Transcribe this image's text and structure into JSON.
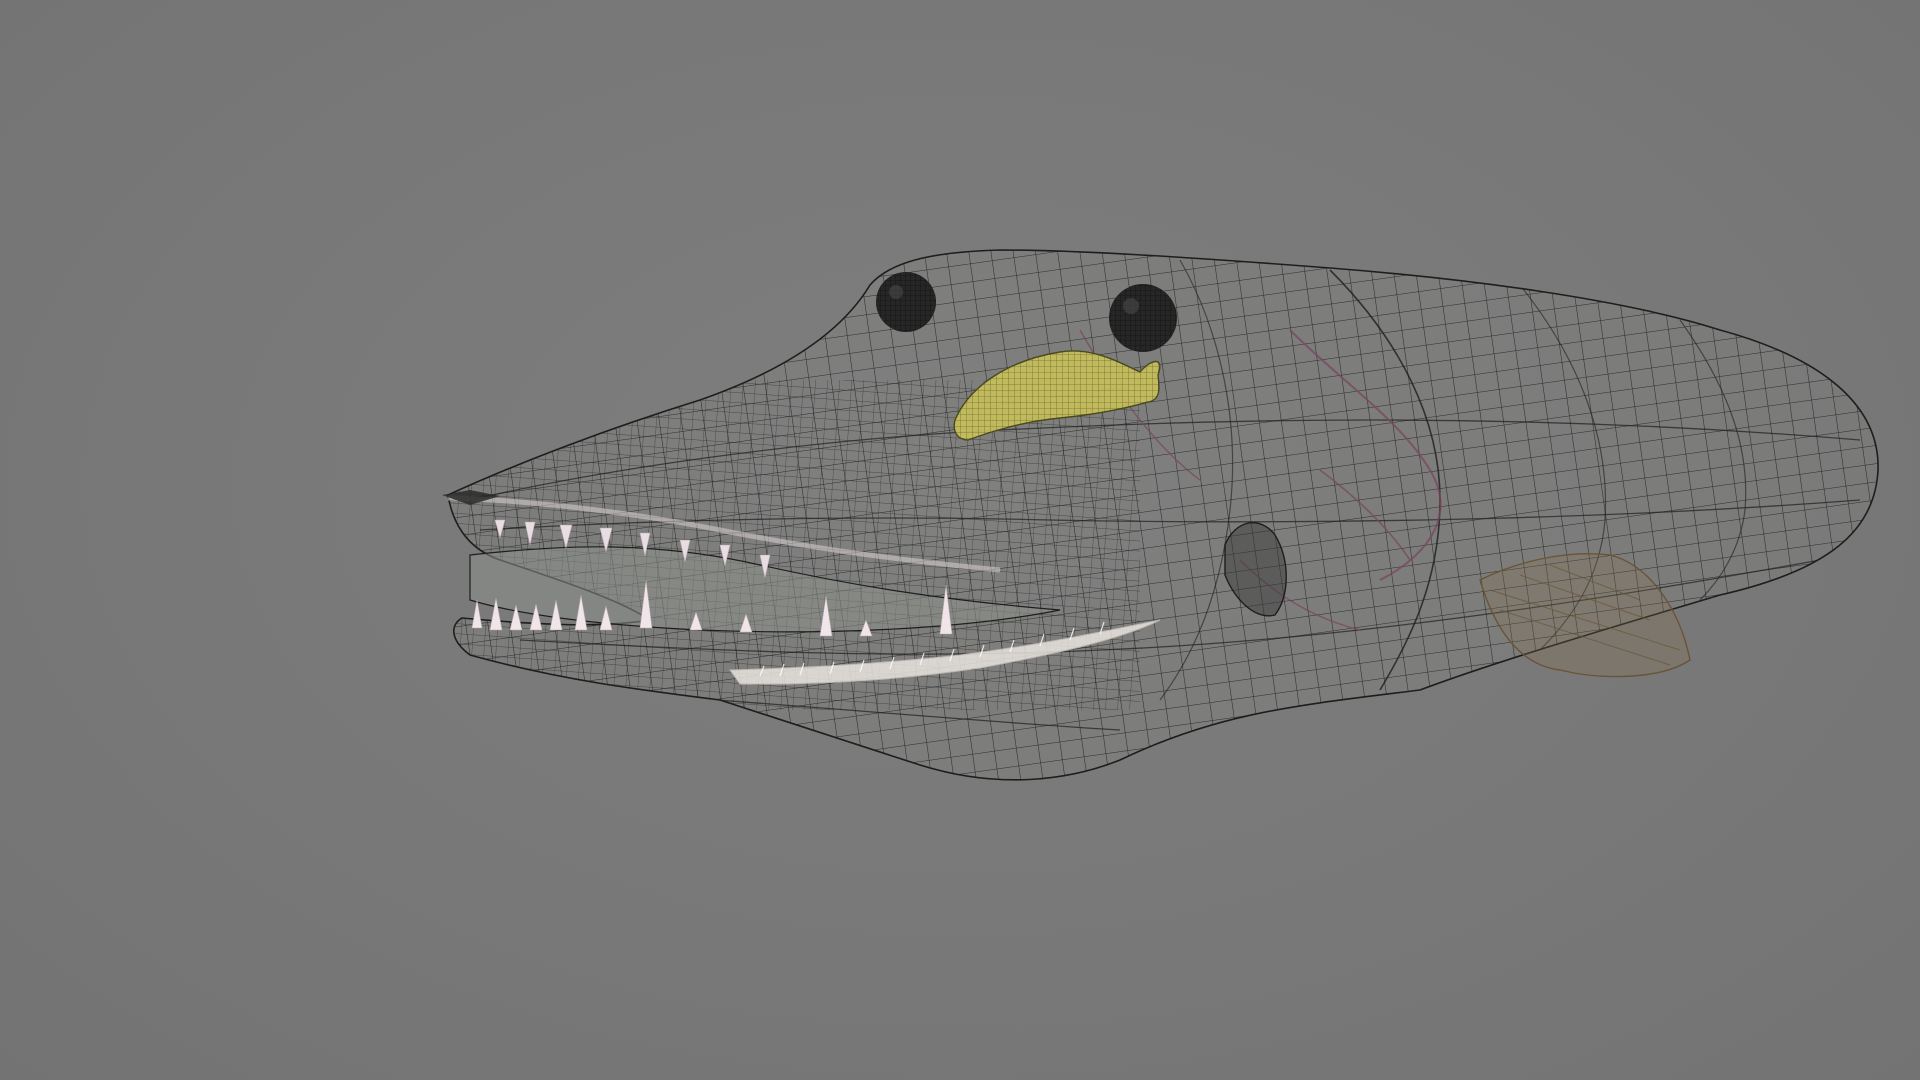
{
  "viewport": {
    "background_color": "#7a7a7a",
    "wire_color": "#1e1e1e",
    "lure_color": "#c9c25a",
    "tooth_color": "#e9dde4",
    "vein_color": "#7a4660",
    "fin_color": "#8a6e4a"
  }
}
